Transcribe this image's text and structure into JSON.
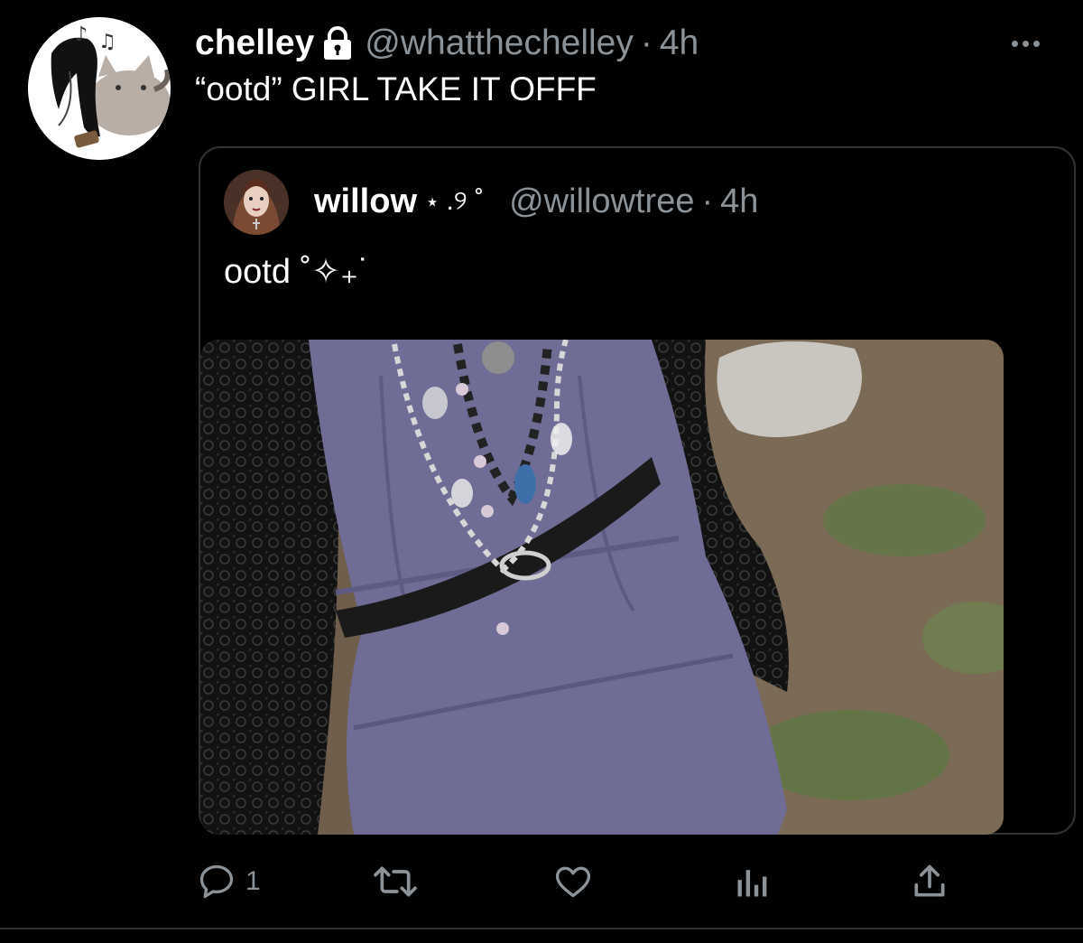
{
  "tweet": {
    "author_name": "chelley",
    "author_handle": "@whatthechelley",
    "separator": "·",
    "time": "4h",
    "text": "“ootd” GIRL TAKE IT OFFF",
    "avatar_icon": "cartoon-cat-avatar",
    "lock_icon": "lock-icon"
  },
  "quoted_tweet": {
    "author_name": "willow",
    "name_decoration": "⋆ .୨ ˚",
    "author_handle": "@willowtree",
    "separator": "·",
    "time": "4h",
    "text": "ootd ˚✧₊˙",
    "media_icon": "outfit-photo"
  },
  "actions": {
    "reply_count": "1",
    "reply_icon": "reply-icon",
    "retweet_icon": "retweet-icon",
    "like_icon": "heart-icon",
    "analytics_icon": "analytics-icon",
    "share_icon": "share-icon"
  },
  "colors": {
    "background": "#000000",
    "text_primary": "#ffffff",
    "text_secondary": "#8b9298",
    "border": "#2f3336"
  }
}
